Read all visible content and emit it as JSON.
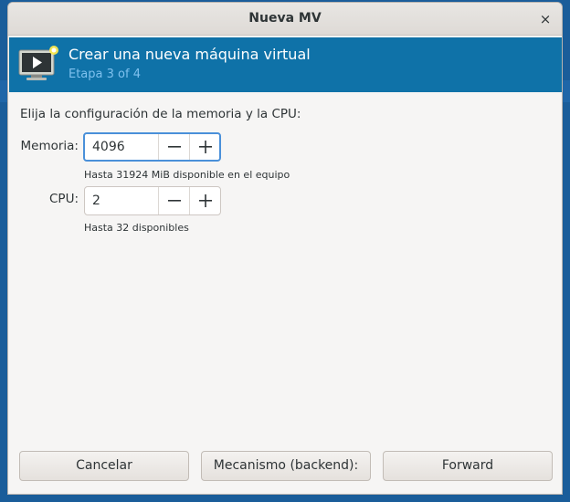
{
  "window": {
    "title": "Nueva MV",
    "close_glyph": "×"
  },
  "banner": {
    "title": "Crear una nueva máquina virtual",
    "step": "Etapa 3 of 4",
    "icon": "monitor-play-icon"
  },
  "form": {
    "prompt": "Elija la configuración de la memoria y la CPU:",
    "memory": {
      "label": "Memoria:",
      "value": "4096",
      "hint": "Hasta 31924 MiB disponible en el equipo"
    },
    "cpu": {
      "label": "CPU:",
      "value": "2",
      "hint": "Hasta 32 disponibles"
    }
  },
  "footer": {
    "cancel_label": "Cancelar",
    "backend_label": "Mecanismo (backend):",
    "forward_label": "Forward"
  },
  "colors": {
    "banner_bg": "#0f72a8",
    "banner_sub": "#7fc1ee",
    "focus_ring": "#4a90d9"
  }
}
